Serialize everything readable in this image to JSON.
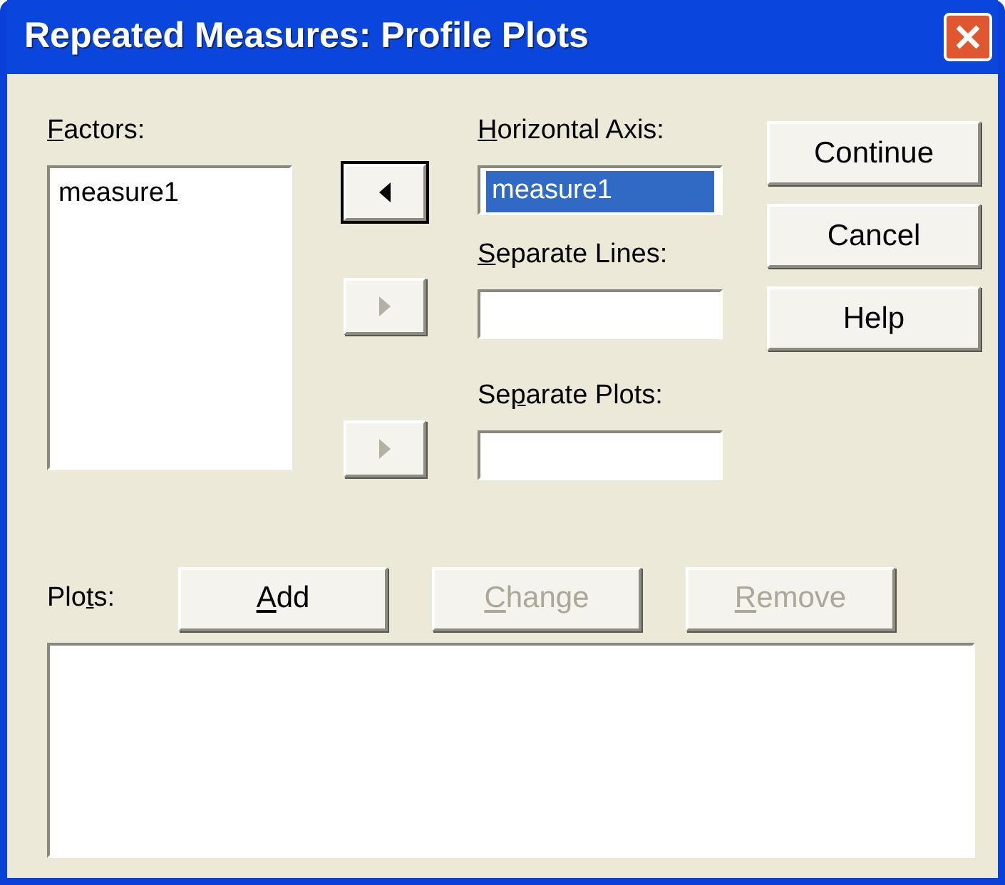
{
  "window": {
    "title": "Repeated Measures: Profile Plots"
  },
  "factors": {
    "label": {
      "key": "F",
      "post": "actors:"
    },
    "items": [
      {
        "text": "measure1",
        "selected": false
      }
    ]
  },
  "move_buttons": [
    {
      "kind": "left",
      "disabled": false,
      "focused": true
    },
    {
      "kind": "right",
      "disabled": true,
      "focused": false
    },
    {
      "kind": "right",
      "disabled": true,
      "focused": false
    }
  ],
  "targets": [
    {
      "label": {
        "key": "H",
        "post": "orizontal Axis:"
      },
      "value": "measure1",
      "selected": true
    },
    {
      "label": {
        "key": "S",
        "post": "eparate Lines:"
      }
    },
    {
      "label": {
        "pre": "Se",
        "key": "p",
        "post": "arate Plots:"
      }
    }
  ],
  "side_buttons": [
    {
      "label": "Continue"
    },
    {
      "label": "Cancel"
    },
    {
      "label": "Help"
    }
  ],
  "plots": {
    "label": {
      "pre": "Plo",
      "key": "t",
      "post": "s:"
    },
    "buttons": [
      {
        "label": {
          "key": "A",
          "post": "dd"
        },
        "disabled": false
      },
      {
        "label": {
          "key": "C",
          "post": "hange"
        },
        "disabled": true
      },
      {
        "label": {
          "key": "R",
          "post": "emove"
        },
        "disabled": true
      }
    ]
  }
}
